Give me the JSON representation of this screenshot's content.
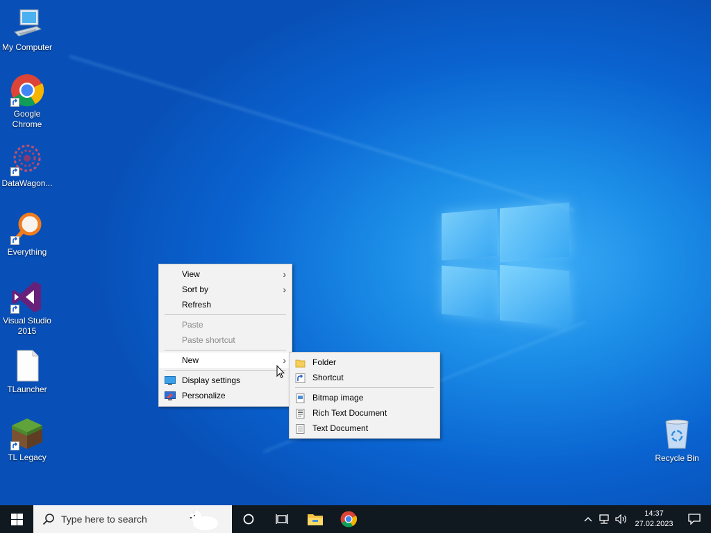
{
  "desktop": {
    "icons": [
      {
        "label": "My Computer",
        "icon": "computer-icon"
      },
      {
        "label": "Google Chrome",
        "icon": "chrome-icon"
      },
      {
        "label": "DataWagon...",
        "icon": "datawagon-icon"
      },
      {
        "label": "Everything",
        "icon": "everything-search-icon"
      },
      {
        "label": "Visual Studio 2015",
        "icon": "visual-studio-icon"
      },
      {
        "label": "TLauncher",
        "icon": "blank-file-icon"
      },
      {
        "label": "TL Legacy",
        "icon": "grass-block-icon"
      },
      {
        "label": "Recycle Bin",
        "icon": "recycle-bin-icon"
      }
    ]
  },
  "context_menu": {
    "view": "View",
    "sort_by": "Sort by",
    "refresh": "Refresh",
    "paste": "Paste",
    "paste_shortcut": "Paste shortcut",
    "new": "New",
    "display_settings": "Display settings",
    "personalize": "Personalize"
  },
  "new_submenu": {
    "folder": "Folder",
    "shortcut": "Shortcut",
    "bitmap": "Bitmap image",
    "rich_text": "Rich Text Document",
    "text_doc": "Text Document"
  },
  "taskbar": {
    "search_placeholder": "Type here to search",
    "time": "14:37",
    "date": "27.02.2023"
  },
  "colors": {
    "taskbar": "#101820",
    "menu_bg": "#f2f2f2",
    "wallpaper_accent": "#1a8be6"
  }
}
